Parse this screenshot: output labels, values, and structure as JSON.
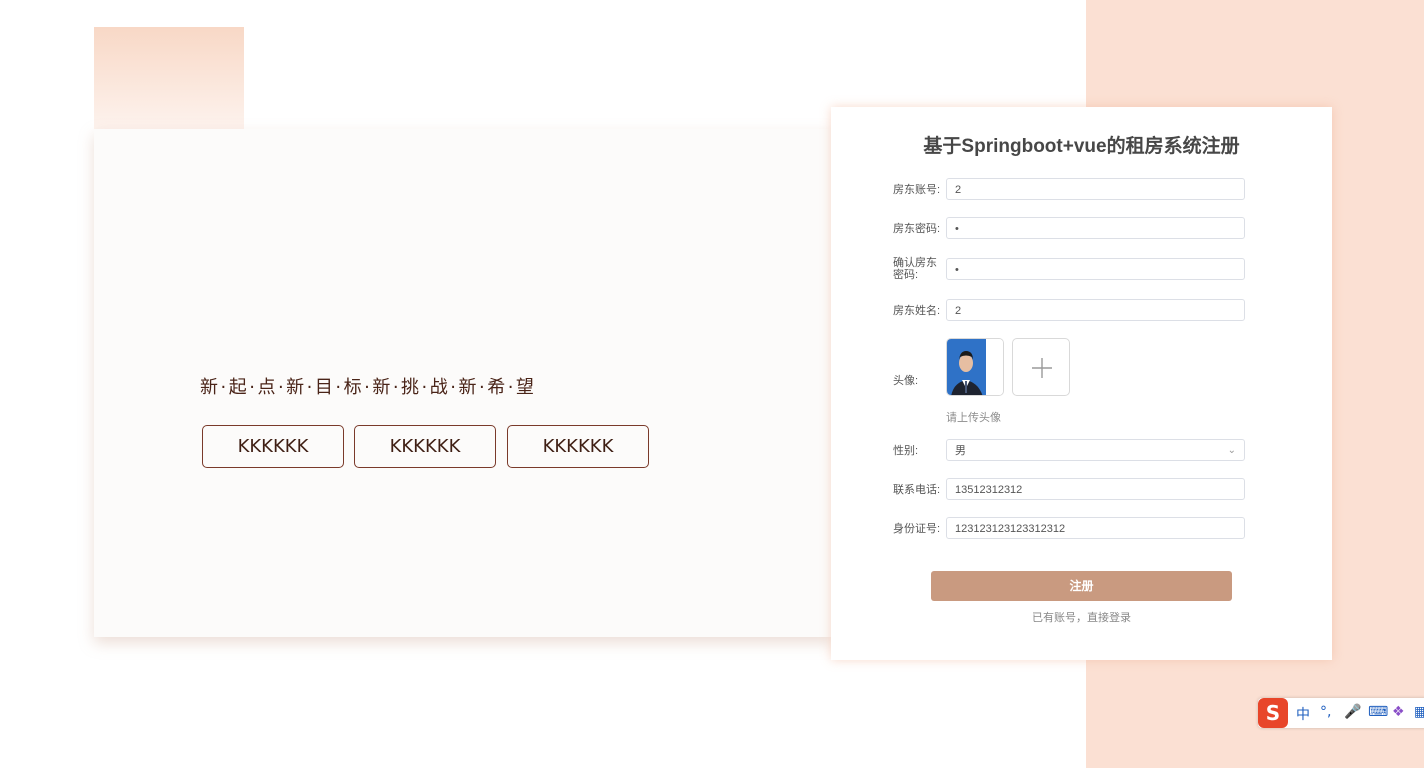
{
  "slogan": "新·起·点·新·目·标·新·挑·战·新·希·望",
  "tags": [
    "KKKKKK",
    "KKKKKK",
    "KKKKKK"
  ],
  "form": {
    "title": "基于Springboot+vue的租房系统注册",
    "fields": {
      "account": {
        "label": "房东账号:",
        "value": "2"
      },
      "password": {
        "label": "房东密码:",
        "value": "•"
      },
      "confirm": {
        "label": "确认房东密码:",
        "value": "•"
      },
      "name": {
        "label": "房东姓名:",
        "value": "2"
      },
      "avatar": {
        "label": "头像:",
        "hint": "请上传头像"
      },
      "gender": {
        "label": "性别:",
        "value": "男"
      },
      "phone": {
        "label": "联系电话:",
        "value": "13512312312"
      },
      "idcard": {
        "label": "身份证号:",
        "value": "123123123123312312"
      }
    },
    "submit": "注册",
    "login_link": "已有账号，直接登录"
  },
  "ime": {
    "logo": "S",
    "lang": "中",
    "punct": "°,"
  },
  "colors": {
    "accent": "#c99a80",
    "peach": "#fbe0d3",
    "slogan": "#4a2418"
  }
}
